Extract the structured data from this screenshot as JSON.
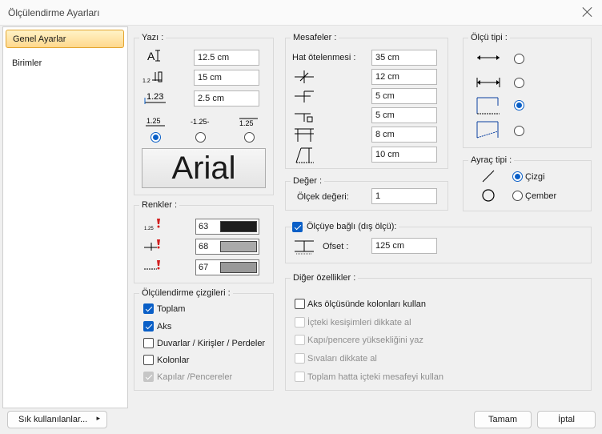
{
  "window": {
    "title": "Ölçülendirme Ayarları"
  },
  "nav": {
    "items": [
      "Genel Ayarlar",
      "Birimler"
    ]
  },
  "yazi": {
    "title": "Yazı :",
    "fields": [
      "12.5 cm",
      "15 cm",
      "2.5 cm"
    ],
    "position_icons": [
      "1.25",
      "-1.25-",
      "1.25"
    ],
    "position_selected": 0,
    "font_name": "Arial"
  },
  "mesafeler": {
    "title": "Mesafeler :",
    "hat_label": "Hat ötelenmesi :",
    "fields": [
      "35 cm",
      "12 cm",
      "5 cm",
      "5 cm",
      "8 cm",
      "10 cm"
    ]
  },
  "olcu_tipi": {
    "title": "Ölçü tipi :",
    "selected": 2
  },
  "ayrac_tipi": {
    "title": "Ayraç tipi :",
    "options": [
      "Çizgi",
      "Çember"
    ],
    "selected": 0
  },
  "renkler": {
    "title": "Renkler :",
    "colors": [
      {
        "value": "63",
        "hex": "#1e1e1e"
      },
      {
        "value": "68",
        "hex": "#aaaaaa"
      },
      {
        "value": "67",
        "hex": "#999999"
      }
    ]
  },
  "deger": {
    "title": "Değer :",
    "label": "Ölçek değeri:",
    "value": "1"
  },
  "disolcu": {
    "label": "Ölçüye bağlı (dış ölçü):",
    "checked": true,
    "ofset_label": "Ofset :",
    "ofset_value": "125 cm"
  },
  "cizgiler": {
    "title": "Ölçülendirme çizgileri :",
    "items": [
      {
        "label": "Toplam",
        "checked": true,
        "enabled": true
      },
      {
        "label": "Aks",
        "checked": true,
        "enabled": true
      },
      {
        "label": "Duvarlar / Kirişler / Perdeler",
        "checked": false,
        "enabled": true
      },
      {
        "label": "Kolonlar",
        "checked": false,
        "enabled": true
      },
      {
        "label": "Kapılar /Pencereler",
        "checked": true,
        "enabled": false
      }
    ]
  },
  "diger": {
    "title": "Diğer özellikler :",
    "items": [
      {
        "label": "Aks ölçüsünde kolonları kullan",
        "enabled": true
      },
      {
        "label": "İçteki kesişimleri dikkate al",
        "enabled": false
      },
      {
        "label": "Kapı/pencere yüksekliğini yaz",
        "enabled": false
      },
      {
        "label": "Sıvaları dikkate al",
        "enabled": false
      },
      {
        "label": "Toplam hatta içteki mesafeyi kullan",
        "enabled": false
      }
    ]
  },
  "footer": {
    "sik": "Sık kullanılanlar...",
    "ok": "Tamam",
    "cancel": "İptal"
  }
}
